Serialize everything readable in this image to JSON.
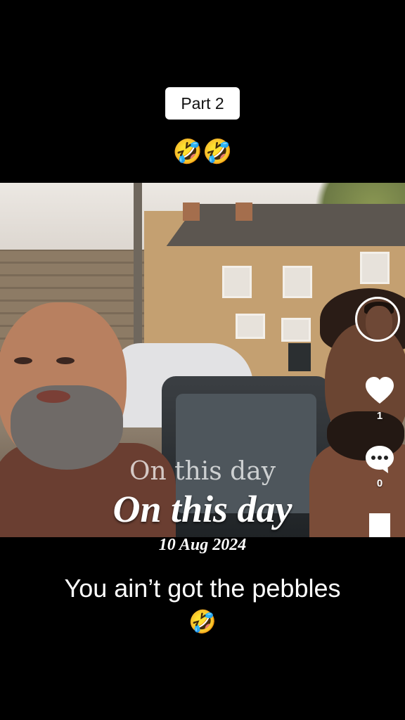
{
  "top_caption": {
    "part_label": "Part 2",
    "emoji": "🤣🤣"
  },
  "video_overlay": {
    "faded_text": "On this day",
    "title": "On this day",
    "date": "10 Aug 2024"
  },
  "actions": {
    "avatar_icon": "creator-avatar",
    "like_count": "1",
    "comment_count": "0",
    "icons": [
      "heart-icon",
      "comment-icon",
      "bookmark-icon"
    ]
  },
  "bottom_caption": {
    "text": "You ain’t got the pebbles",
    "emoji": "🤣"
  }
}
